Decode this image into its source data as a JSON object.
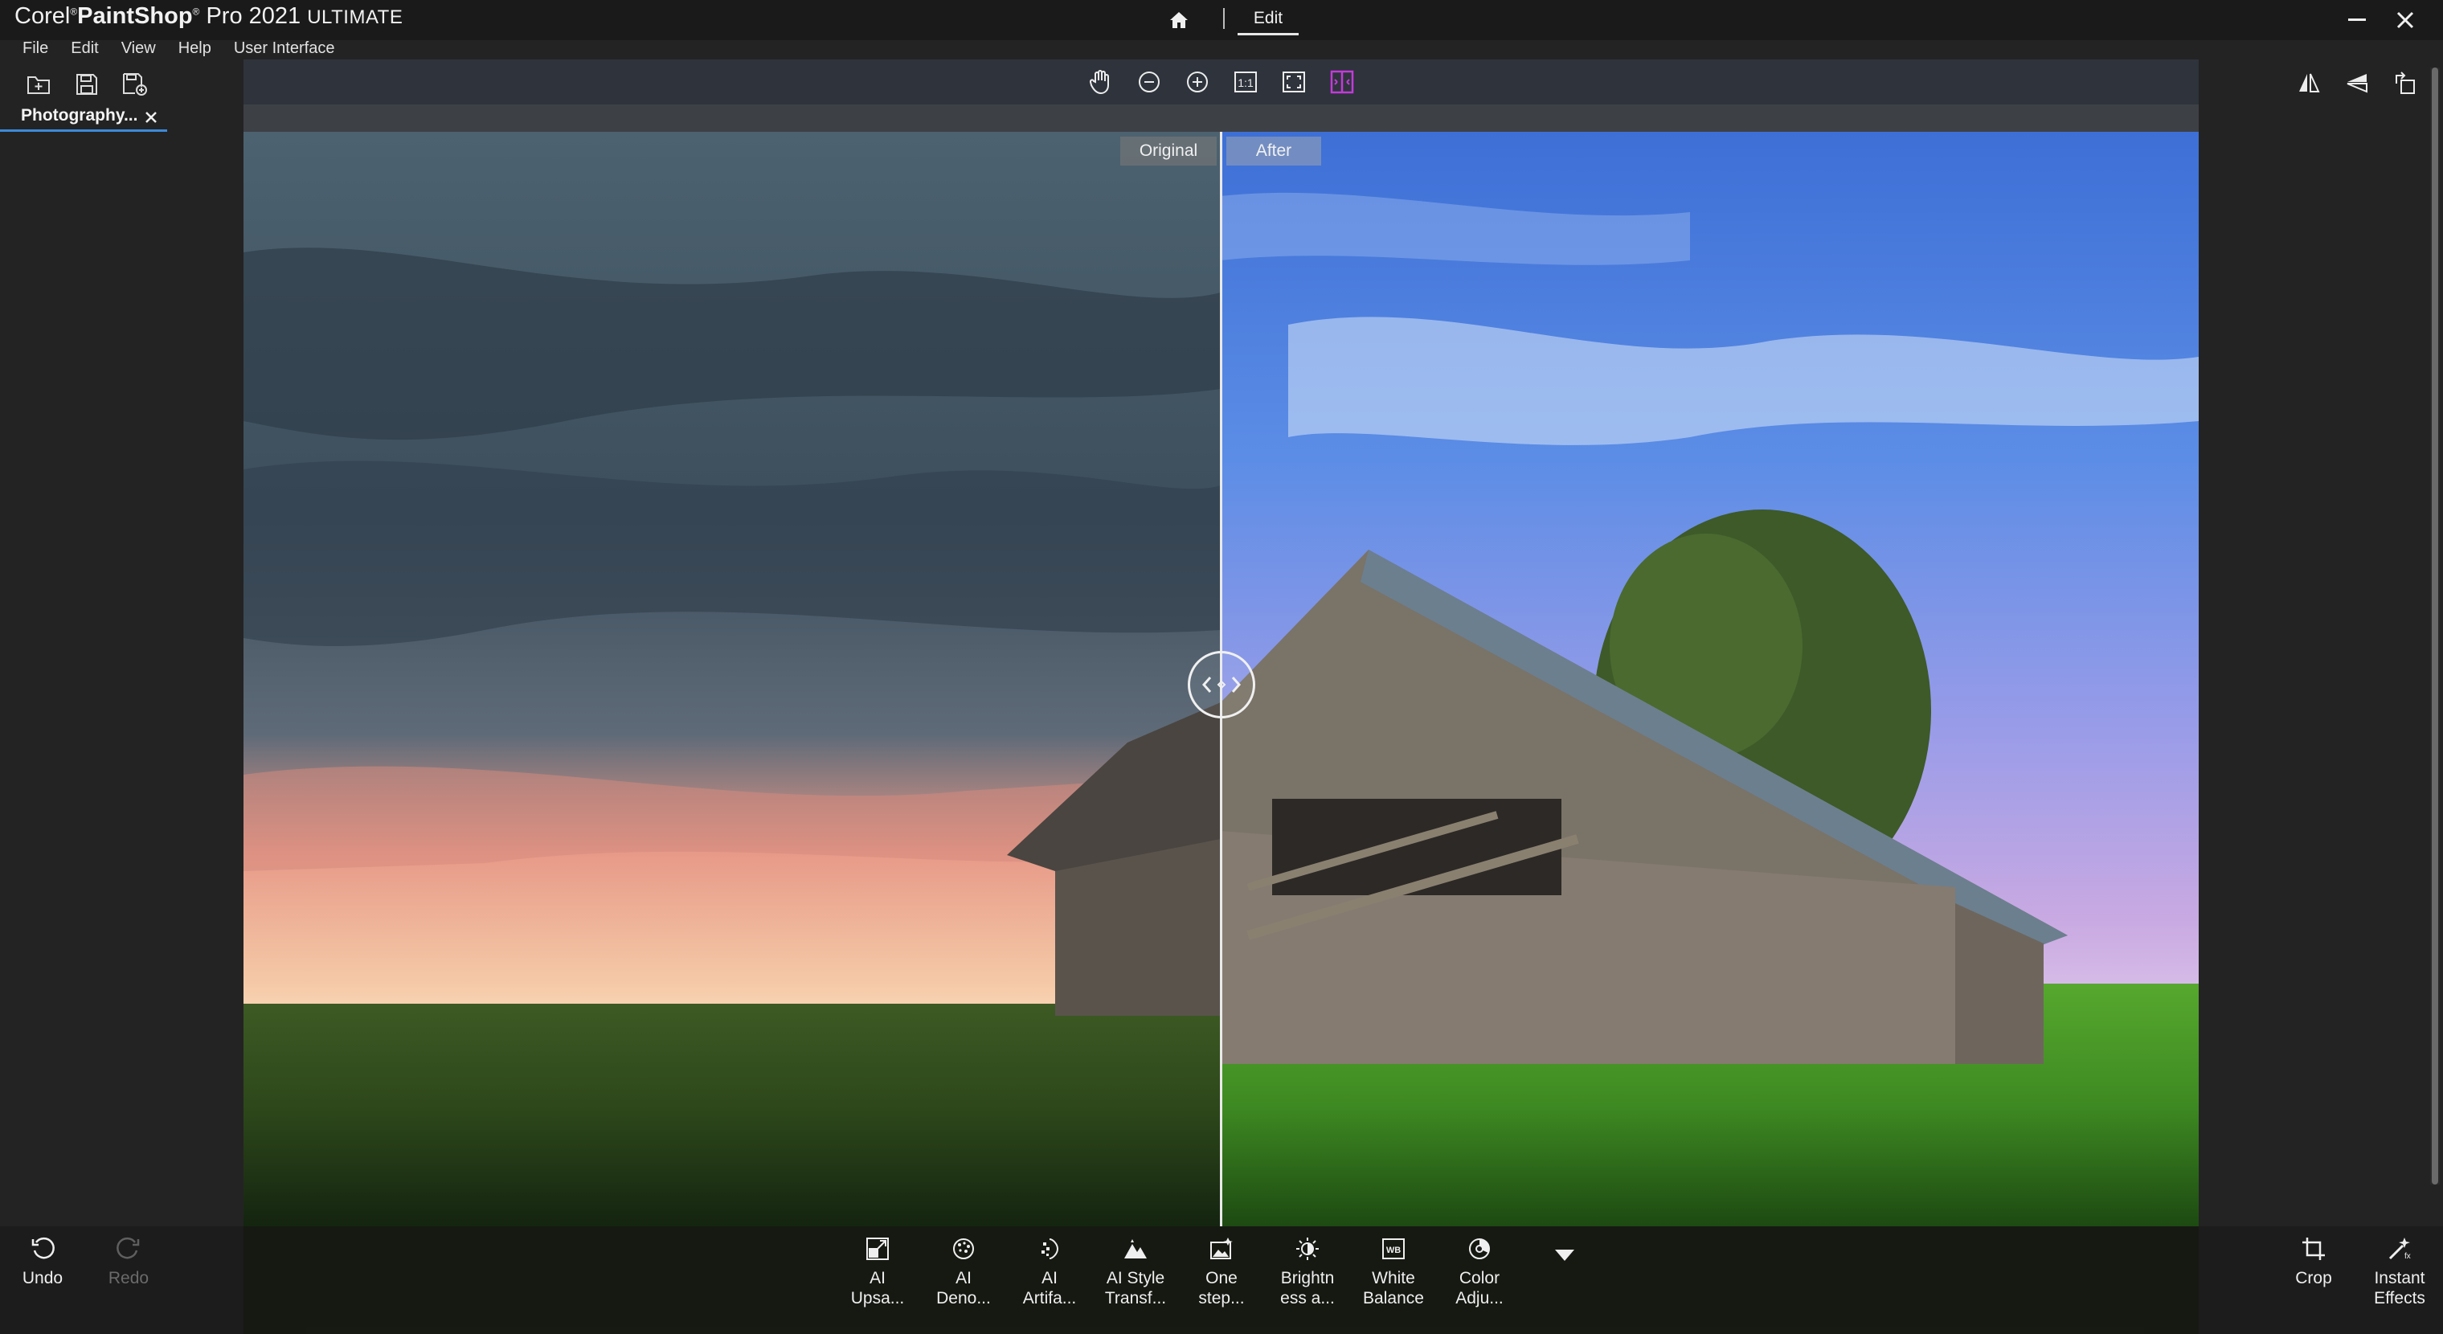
{
  "titlebar": {
    "brand_prefix": "Corel",
    "brand_sup": "®",
    "brand_main": "PaintShop",
    "brand_sup2": "®",
    "brand_suffix": "Pro 2021",
    "edition": "ULTIMATE",
    "mode_tab": "Edit",
    "home_icon": "home-icon",
    "minimize_icon": "minimize-icon",
    "close_icon": "close-icon"
  },
  "menu": {
    "items": [
      "File",
      "Edit",
      "View",
      "Help",
      "User Interface"
    ]
  },
  "file_toolbar": {
    "icons": [
      "open-icon",
      "save-icon",
      "save-as-icon"
    ]
  },
  "document_tab": {
    "label": "Photography...",
    "close_icon": "close-tab-icon"
  },
  "view_toolbar": {
    "icons": [
      "pan-hand-icon",
      "zoom-out-icon",
      "zoom-in-icon",
      "actual-size-icon",
      "fit-to-window-icon",
      "compare-split-icon"
    ],
    "actual_size_text": "1:1",
    "active_color": "#c23bd8"
  },
  "right_toolbar": {
    "icons": [
      "flip-horizontal-icon",
      "flip-vertical-icon",
      "rotate-icon"
    ]
  },
  "compare": {
    "original_label": "Original",
    "after_label": "After"
  },
  "bottom_toolbar": {
    "undo_label": "Undo",
    "redo_label": "Redo",
    "tools": [
      {
        "label": "AI\nUpsa...",
        "icon": "ai-upsampling-icon"
      },
      {
        "label": "AI\nDeno...",
        "icon": "ai-denoise-icon"
      },
      {
        "label": "AI\nArtifa...",
        "icon": "ai-artifact-removal-icon"
      },
      {
        "label": "AI Style\nTransf...",
        "icon": "ai-style-transfer-icon"
      },
      {
        "label": "One\nstep...",
        "icon": "one-step-photo-fix-icon"
      },
      {
        "label": "Brightn\ness a...",
        "icon": "brightness-icon"
      },
      {
        "label": "White\nBalance",
        "icon": "white-balance-icon"
      },
      {
        "label": "Color\nAdju...",
        "icon": "color-adjust-icon"
      }
    ],
    "more_icon": "more-tools-icon",
    "wb_glyph": "WB",
    "crop_label": "Crop",
    "instant_effects_label": "Instant\nEffects"
  }
}
